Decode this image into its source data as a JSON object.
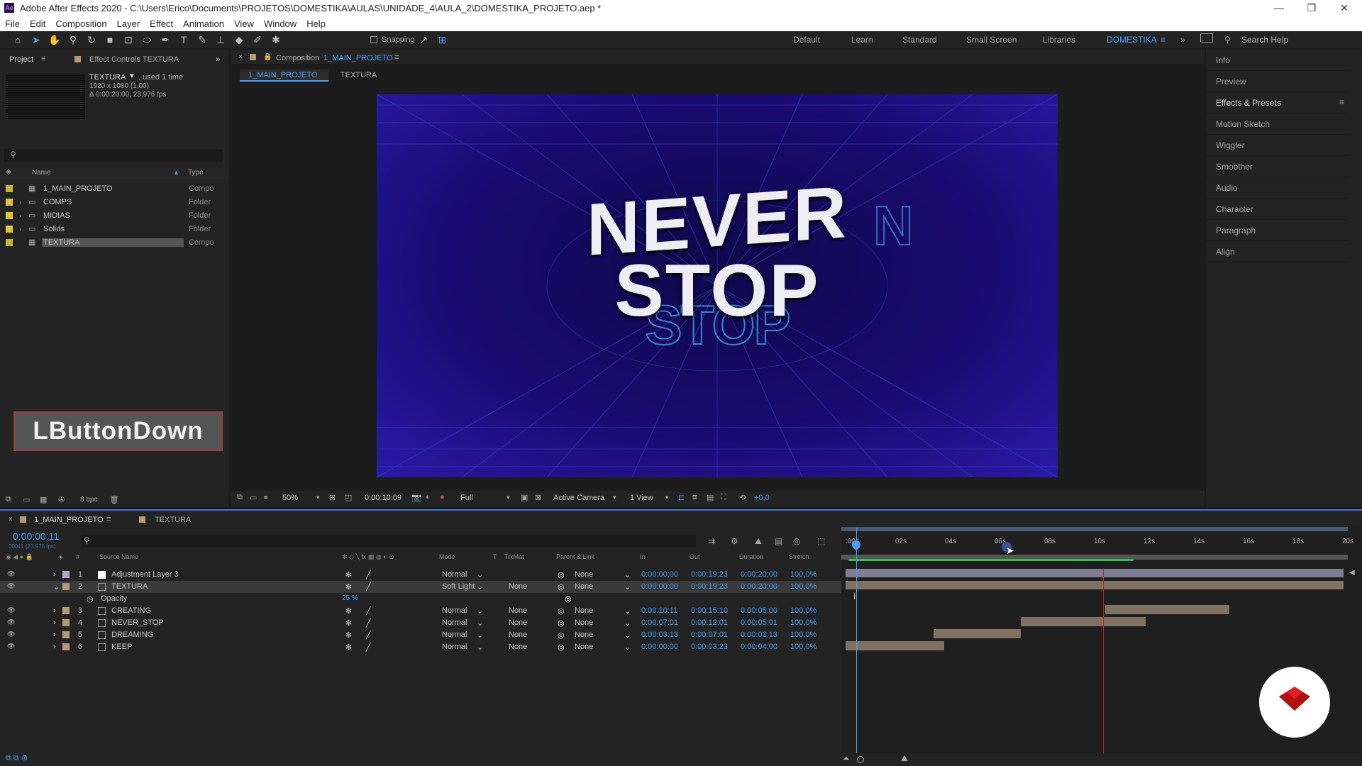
{
  "window": {
    "title": "Adobe After Effects 2020 - C:\\Users\\Erico\\Documents\\PROJETOS\\DOMESTIKA\\AULAS\\UNIDADE_4\\AULA_2\\DOMESTIKA_PROJETO.aep *"
  },
  "menu": [
    "File",
    "Edit",
    "Composition",
    "Layer",
    "Effect",
    "Animation",
    "View",
    "Window",
    "Help"
  ],
  "toolbar": {
    "snapping": "Snapping",
    "workspaces": [
      "Default",
      "Learn",
      "Standard",
      "Small Screen",
      "Libraries",
      "DOMESTIKA"
    ],
    "search_help": "Search Help"
  },
  "project": {
    "tab": "Project",
    "effect_controls": "Effect Controls TEXTURA",
    "item_name": "TEXTURA",
    "item_used": ", used 1 time",
    "item_dims": "1920 x 1080 (1,00)",
    "item_duration": "Δ 0:00:20:00, 23,976 fps",
    "col_name": "Name",
    "col_type": "Type",
    "bpc": "8 bpc",
    "items": [
      {
        "name": "1_MAIN_PROJETO",
        "type": "Compo",
        "color": "#c8b43c"
      },
      {
        "name": "COMPS",
        "type": "Folder",
        "color": "#e0c440"
      },
      {
        "name": "MIDIAS",
        "type": "Folder",
        "color": "#e0c440"
      },
      {
        "name": "Solids",
        "type": "Folder",
        "color": "#e0c440"
      },
      {
        "name": "TEXTURA",
        "type": "Compo",
        "color": "#c8b43c"
      }
    ]
  },
  "overlay_label": "LButtonDown",
  "comp": {
    "panel_title": "Composition",
    "comp_name": "1_MAIN_PROJETO",
    "tabs": [
      "1_MAIN_PROJETO",
      "TEXTURA"
    ],
    "headline_1": "NEVER",
    "headline_2": "STOP",
    "zoom": "50%",
    "timecode": "0:00:10:09",
    "resolution": "Full",
    "camera": "Active Camera",
    "views": "1 View",
    "exposure": "+0,0"
  },
  "right_panel": [
    "Info",
    "Preview",
    "Effects & Presets",
    "Motion Sketch",
    "Wiggler",
    "Smoother",
    "Audio",
    "Character",
    "Paragraph",
    "Align"
  ],
  "timeline": {
    "tabs": [
      "1_MAIN_PROJETO",
      "TEXTURA"
    ],
    "timecode": "0:00:00:11",
    "frames": "00011 (23.976 fps)",
    "cols": {
      "source": "Source Name",
      "mode": "Mode",
      "t": "T",
      "trkmat": "TrkMat",
      "parent": "Parent & Link",
      "in": "In",
      "out": "Out",
      "duration": "Duration",
      "stretch": "Stretch"
    },
    "layers": [
      {
        "num": "1",
        "name": "Adjustment Layer 3",
        "mode": "Normal",
        "trk": "",
        "parent": "None",
        "in": "0:00:00:00",
        "out": "0:00:19:23",
        "dur": "0:00:20:00",
        "stretch": "100,0%"
      },
      {
        "num": "2",
        "name": "TEXTURA",
        "mode": "Soft Light",
        "trk": "None",
        "parent": "None",
        "in": "0:00:00:00",
        "out": "0:00:19:23",
        "dur": "0:00:20:00",
        "stretch": "100,0%"
      },
      {
        "num": "3",
        "name": "CREATING",
        "mode": "Normal",
        "trk": "None",
        "parent": "None",
        "in": "0:00:10:11",
        "out": "0:00:15:10",
        "dur": "0:00:05:00",
        "stretch": "100,0%"
      },
      {
        "num": "4",
        "name": "NEVER_STOP",
        "mode": "Normal",
        "trk": "None",
        "parent": "None",
        "in": "0:00:07:01",
        "out": "0:00:12:01",
        "dur": "0:00:05:01",
        "stretch": "100,0%"
      },
      {
        "num": "5",
        "name": "DREAMING",
        "mode": "Normal",
        "trk": "None",
        "parent": "None",
        "in": "0:00:03:13",
        "out": "0:00:07:01",
        "dur": "0:00:03:13",
        "stretch": "100,0%"
      },
      {
        "num": "6",
        "name": "KEEP",
        "mode": "Normal",
        "trk": "None",
        "parent": "None",
        "in": "0:00:00:00",
        "out": "0:00:03:23",
        "dur": "0:00:04:00",
        "stretch": "100,0%"
      }
    ],
    "opacity_label": "Opacity",
    "opacity_value": "25 %",
    "ruler": [
      ":00s",
      "02s",
      "04s",
      "06s",
      "08s",
      "10s",
      "12s",
      "14s",
      "16s",
      "18s",
      "20s"
    ]
  },
  "colors": {
    "accent": "#4a9cf2",
    "comp_bg": "#1a0a70",
    "layer_bar": "#7f7262",
    "layer_label_tan": "#b59a7a",
    "playhead": "#4a9cf2",
    "end_marker": "#cc2222"
  }
}
